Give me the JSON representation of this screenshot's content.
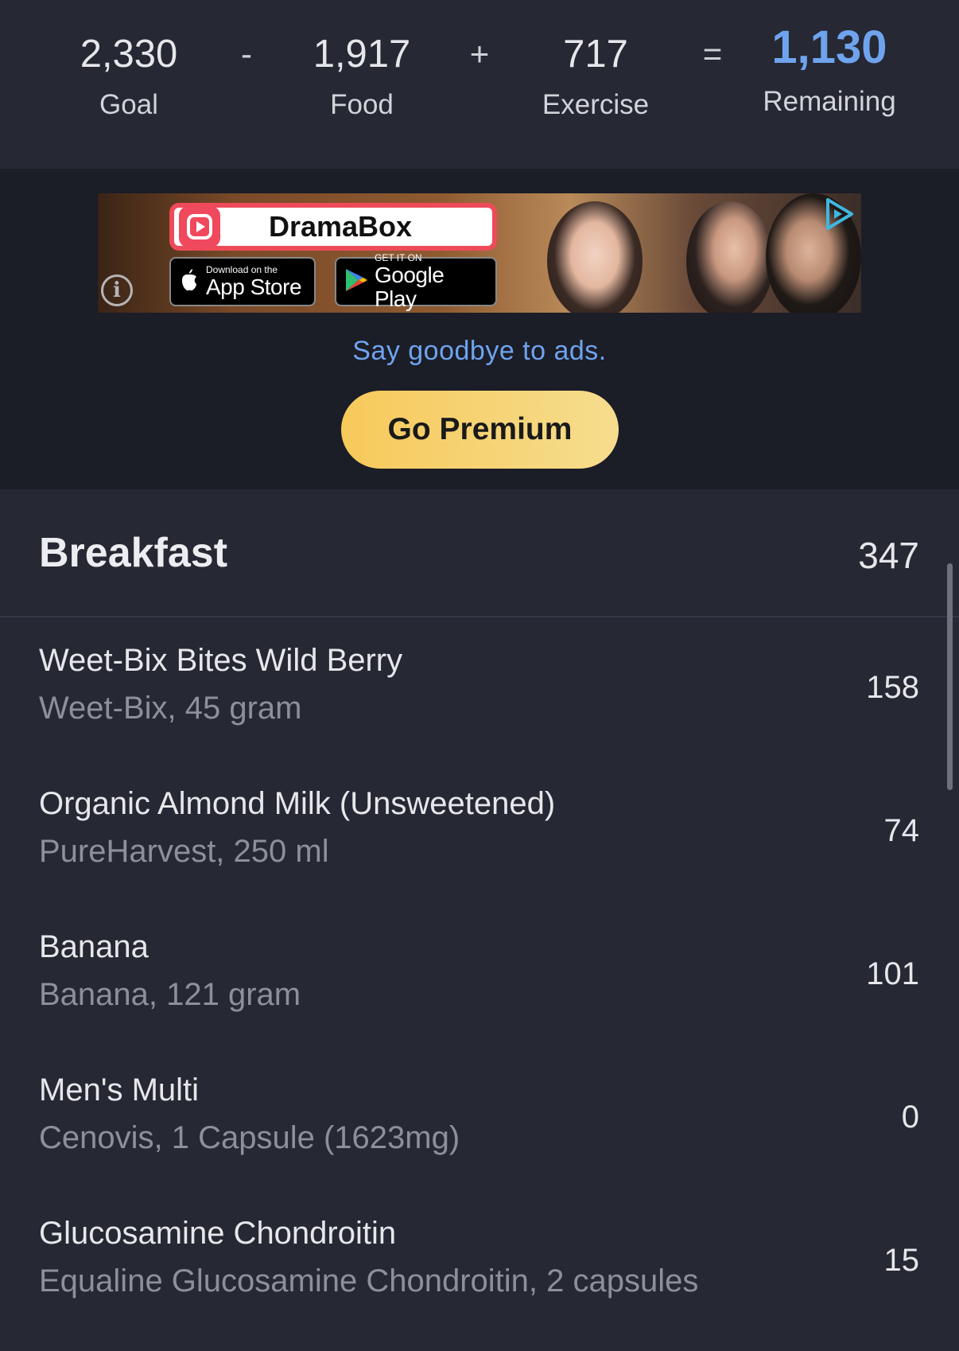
{
  "summary": {
    "goal": {
      "value": "2,330",
      "label": "Goal"
    },
    "op1": "-",
    "food": {
      "value": "1,917",
      "label": "Food"
    },
    "op2": "+",
    "exercise": {
      "value": "717",
      "label": "Exercise"
    },
    "op3": "=",
    "remaining": {
      "value": "1,130",
      "label": "Remaining"
    }
  },
  "ad": {
    "brand": "DramaBox",
    "app_store_small": "Download on the",
    "app_store_big": "App Store",
    "google_small": "GET IT ON",
    "google_big": "Google Play",
    "info_glyph": "i",
    "goodbye_text": "Say goodbye to ads.",
    "premium_label": "Go Premium"
  },
  "meal": {
    "title": "Breakfast",
    "total": "347",
    "items": [
      {
        "name": "Weet-Bix Bites Wild Berry",
        "desc": "Weet-Bix, 45 gram",
        "cal": "158"
      },
      {
        "name": "Organic Almond Milk (Unsweetened)",
        "desc": "PureHarvest, 250 ml",
        "cal": "74"
      },
      {
        "name": "Banana",
        "desc": "Banana, 121 gram",
        "cal": "101"
      },
      {
        "name": "Men's Multi",
        "desc": "Cenovis, 1 Capsule (1623mg)",
        "cal": "0"
      },
      {
        "name": "Glucosamine Chondroitin",
        "desc": "Equaline Glucosamine Chondroitin, 2 capsules",
        "cal": "15"
      }
    ]
  },
  "colors": {
    "background": "#262833",
    "ad_background": "#1b1d27",
    "accent_blue": "#6fa3ee",
    "premium_gold": "#f7c95a"
  }
}
